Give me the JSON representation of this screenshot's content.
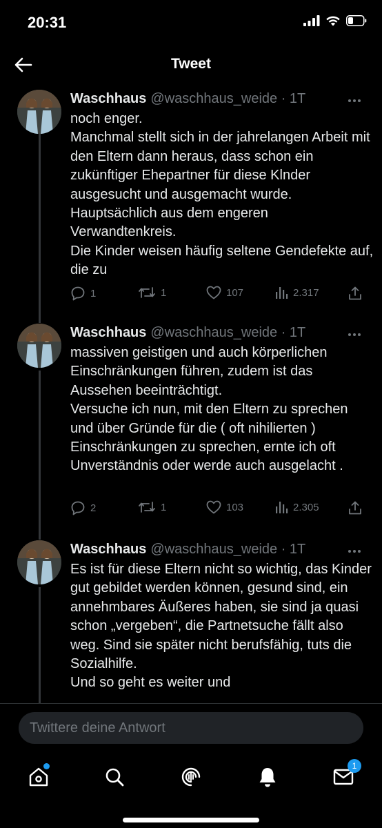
{
  "status": {
    "time": "20:31"
  },
  "header": {
    "title": "Tweet"
  },
  "tweets": [
    {
      "author": "Waschhaus",
      "handle": "@waschhaus_weide · 1T",
      "text": "noch enger.\nManchmal stellt sich in der jahrelangen Arbeit mit den Eltern dann heraus, dass schon ein zukünftiger Ehepartner für diese Klnder ausgesucht und ausgemacht wurde.\nHauptsächlich aus dem engeren Verwandtenkreis.\nDie Kinder weisen häufig seltene Gendefekte auf, die zu",
      "replies": "1",
      "retweets": "1",
      "likes": "107",
      "views": "2.317"
    },
    {
      "author": "Waschhaus",
      "handle": "@waschhaus_weide · 1T",
      "text": "massiven geistigen und auch körperlichen Einschränkungen führen, zudem ist das Aussehen beeinträchtigt.\nVersuche ich nun, mit den Eltern zu sprechen und über Gründe für die ( oft nihilierten ) Einschränkungen zu sprechen, ernte ich oft Unverständnis oder werde auch ausgelacht .",
      "replies": "2",
      "retweets": "1",
      "likes": "103",
      "views": "2.305"
    },
    {
      "author": "Waschhaus",
      "handle": "@waschhaus_weide · 1T",
      "text": "Es ist für diese Eltern nicht so wichtig, das Kinder gut gebildet werden können, gesund sind, ein annehmbares Äußeres haben, sie sind ja quasi schon „vergeben“, die Partnetsuche fällt also weg. Sind sie später nicht berufsfähig, tuts die Sozialhilfe.\nUnd so geht es weiter und"
    }
  ],
  "compose": {
    "placeholder": "Twittere deine Antwort"
  },
  "tabbar": {
    "messages_badge": "1"
  },
  "colors": {
    "accent": "#1d9bf0",
    "muted": "#71767b",
    "text": "#e7e9ea",
    "background": "#000000"
  }
}
